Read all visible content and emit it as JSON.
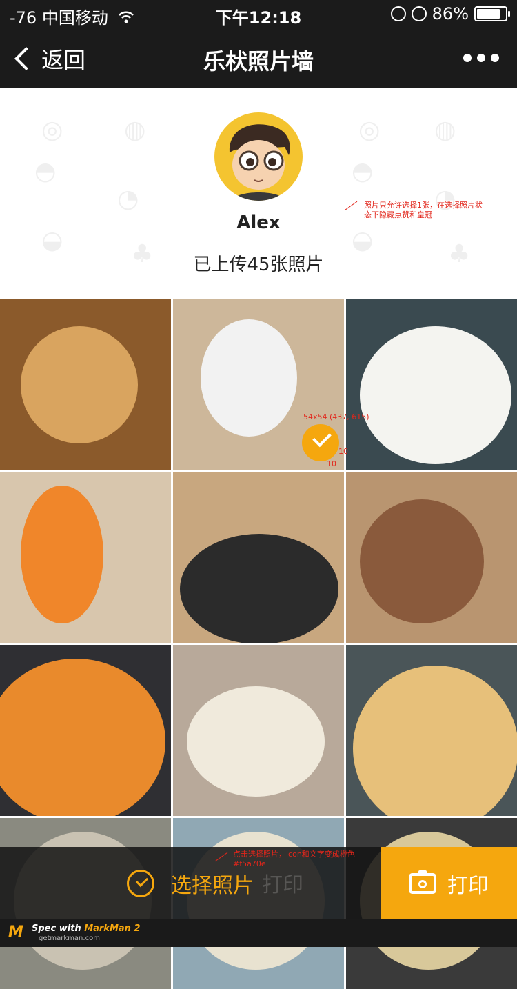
{
  "status_bar": {
    "carrier": "-76 中国移动",
    "time": "下午12:18",
    "battery": "86%",
    "battery_level": 0.86
  },
  "nav": {
    "back_label": "返回",
    "title": "乐枤照片墙"
  },
  "profile": {
    "name": "Alex",
    "upload_text": "已上传45张照片"
  },
  "annotations": {
    "note_top": "照片只允许选择1张，在选择照片状态下隐藏点赞和皇冠",
    "note_bottom": "点击选择照片，icon和文字变成橙色 #f5a70e",
    "check_measure": "54x54 (437, 615)",
    "gap_right": "10",
    "gap_bottom": "10"
  },
  "photos": [
    {
      "name": "cookies-photo",
      "bg": "#8b5a2b",
      "plate": "#d9a45f"
    },
    {
      "name": "coffee-cup-photo",
      "bg": "#cdb79a",
      "plate": "#f2f2f2"
    },
    {
      "name": "salad-photo",
      "bg": "#3a4a50",
      "plate": "#f4f4f0"
    },
    {
      "name": "orange-juice-photo",
      "bg": "#d8c6ad",
      "plate": "#f0862a"
    },
    {
      "name": "rice-curry-photo",
      "bg": "#c8a77f",
      "plate": "#2b2b2b"
    },
    {
      "name": "steak-fries-photo",
      "bg": "#b99570",
      "plate": "#8a5a3c"
    },
    {
      "name": "pasta-photo",
      "bg": "#2f2f33",
      "plate": "#e98a2c"
    },
    {
      "name": "soup-bowl-photo",
      "bg": "#b8a99a",
      "plate": "#f0eadc"
    },
    {
      "name": "pizza-photo",
      "bg": "#4a5558",
      "plate": "#e7c07a"
    },
    {
      "name": "partial-photo-1",
      "bg": "#8a8a80",
      "plate": "#c9c2b2"
    },
    {
      "name": "partial-photo-2",
      "bg": "#90a8b4",
      "plate": "#e8e2d0"
    },
    {
      "name": "partial-photo-3",
      "bg": "#3a3a3a",
      "plate": "#d8c89a"
    }
  ],
  "bottom_bar": {
    "select_label": "选择照片",
    "print_label": "打印",
    "accent_color": "#f5a70e"
  },
  "watermark": {
    "brand_prefix": "Spec with",
    "brand": "MarkMan 2",
    "site": "getmarkman.com"
  }
}
